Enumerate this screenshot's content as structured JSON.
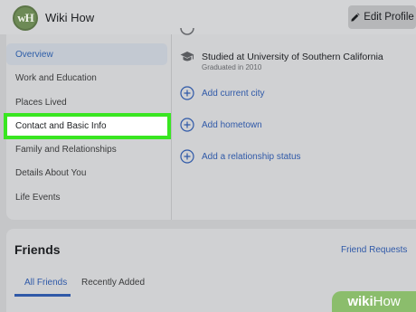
{
  "header": {
    "avatar_initials": "wH",
    "profile_name": "Wiki How",
    "edit_profile_label": "Edit Profile",
    "edit_icon": "pencil-icon"
  },
  "about_nav": {
    "items": [
      {
        "label": "Overview"
      },
      {
        "label": "Work and Education"
      },
      {
        "label": "Places Lived"
      },
      {
        "label": "Contact and Basic Info"
      },
      {
        "label": "Family and Relationships"
      },
      {
        "label": "Details About You"
      },
      {
        "label": "Life Events"
      }
    ],
    "selected_index": 0,
    "highlighted_index": 3
  },
  "overview": {
    "education": {
      "icon": "graduation-cap-icon",
      "text": "Studied at University of Southern California",
      "subtext": "Graduated in 2010"
    },
    "add_links": [
      {
        "label": "Add current city",
        "icon": "plus-circle-icon"
      },
      {
        "label": "Add hometown",
        "icon": "plus-circle-icon"
      },
      {
        "label": "Add a relationship status",
        "icon": "plus-circle-icon"
      }
    ]
  },
  "friends": {
    "title": "Friends",
    "friend_requests_label": "Friend Requests",
    "tabs": [
      {
        "label": "All Friends",
        "active": true
      },
      {
        "label": "Recently Added",
        "active": false
      }
    ]
  },
  "watermark": {
    "brand_bold": "wiki",
    "brand_regular": "How"
  },
  "colors": {
    "link_blue": "#2f59a8",
    "highlight_green": "#39e621",
    "watermark_green": "#8bbd6c"
  }
}
